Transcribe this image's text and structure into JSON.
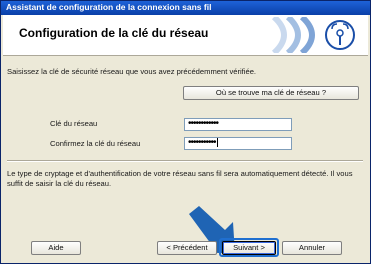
{
  "window": {
    "title": "Assistant de configuration de la connexion sans fil"
  },
  "header": {
    "title": "Configuration de la clé du réseau",
    "logo_icon": "wireless-signal-icon"
  },
  "content": {
    "instruction": "Saisissez la clé de sécurité réseau que vous avez précédemment vérifiée.",
    "where_key_button": "Où se trouve ma clé de réseau ?",
    "network_key_label": "Clé du réseau",
    "network_key_value": "••••••••••••",
    "confirm_key_label": "Confirmez la clé du réseau",
    "confirm_key_value": "•••••••••••",
    "info_text": "Le type de cryptage et d'authentification de votre réseau sans fil sera automatiquement détecté. Il vous suffit de saisir la clé du réseau."
  },
  "footer": {
    "help_button": "Aide",
    "back_button": "< Précédent",
    "next_button": "Suivant >",
    "cancel_button": "Annuler"
  },
  "colors": {
    "title_bar": "#0a3fa8",
    "arrow": "#1f64b4",
    "highlight_box": "#1f6fd0"
  }
}
